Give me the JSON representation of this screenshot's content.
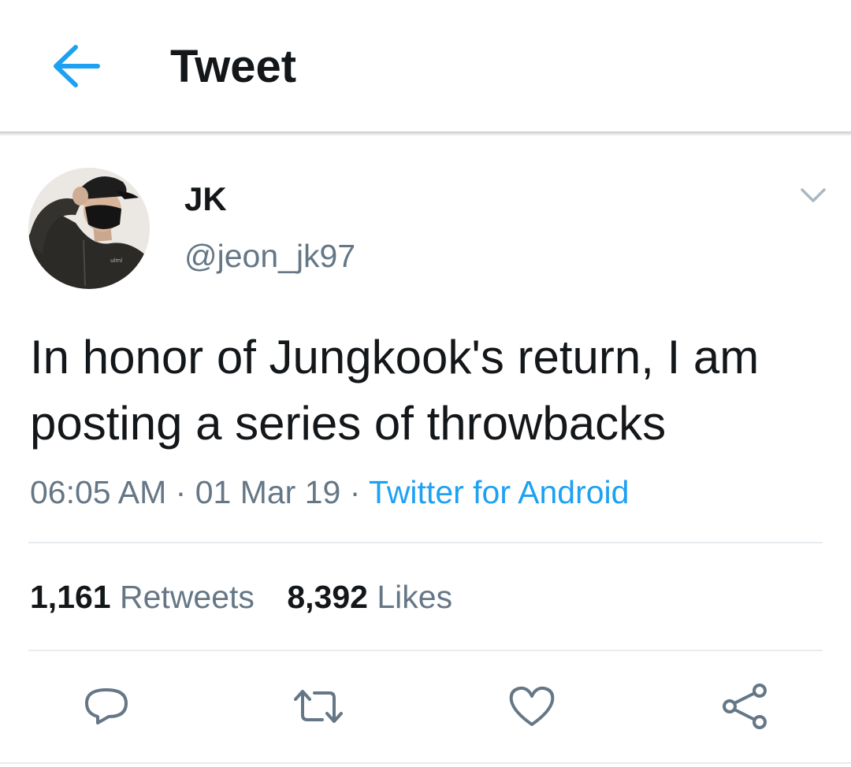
{
  "header": {
    "title": "Tweet",
    "back_icon": "arrow-left-icon",
    "accent_color": "#1da1f2"
  },
  "tweet": {
    "author": {
      "display_name": "JK",
      "handle": "@jeon_jk97",
      "avatar": "profile-photo"
    },
    "text_lines": [
      "In honor of Jungkook's return, I am",
      "posting a series of throwbacks"
    ],
    "time": "06:05 AM",
    "date": "01 Mar 19",
    "separator": "·",
    "source": "Twitter for Android",
    "stats": {
      "retweets_count": "1,161",
      "retweets_label": "Retweets",
      "likes_count": "8,392",
      "likes_label": "Likes"
    },
    "actions": [
      {
        "name": "reply",
        "icon": "reply-icon"
      },
      {
        "name": "retweet",
        "icon": "retweet-icon"
      },
      {
        "name": "like",
        "icon": "heart-icon"
      },
      {
        "name": "share",
        "icon": "share-icon"
      }
    ]
  },
  "colors": {
    "text_primary": "#14171a",
    "text_secondary": "#657786",
    "link": "#1da1f2",
    "divider": "#e6ecf0"
  }
}
